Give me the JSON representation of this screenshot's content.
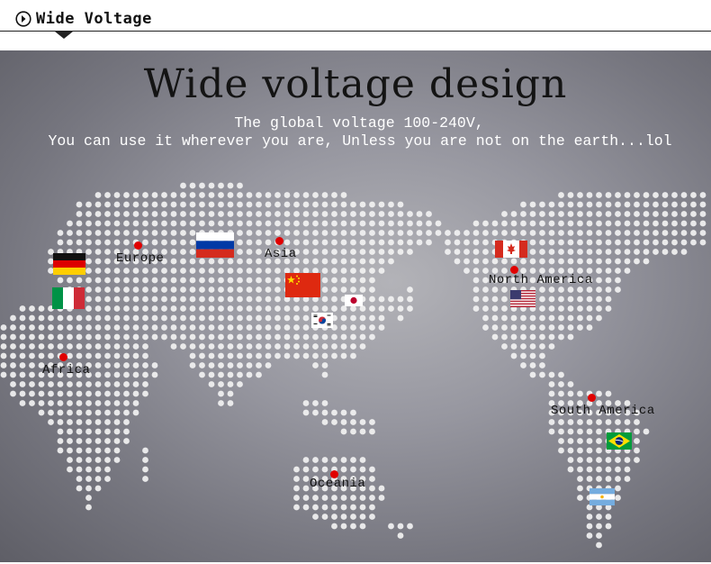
{
  "header": {
    "icon": "circle-chevron-right-icon",
    "title": "Wide Voltage"
  },
  "banner": {
    "title": "Wide voltage design",
    "subtitle_line1": "The global voltage 100-240V,",
    "subtitle_line2": "You can use it wherever you are, Unless you are not on the earth...lol"
  },
  "regions": {
    "europe": "Europe",
    "asia": "Asia",
    "africa": "Africa",
    "oceania": "Oceania",
    "north_america": "North America",
    "south_america": "South America"
  },
  "flags": [
    "germany",
    "italy",
    "russia",
    "china",
    "japan",
    "south-korea",
    "canada",
    "usa",
    "brazil",
    "argentina"
  ],
  "colors": {
    "map_dots": "#f2f2f2",
    "pin": "#e00000",
    "subtitle": "#ffffff",
    "title": "#141414"
  }
}
